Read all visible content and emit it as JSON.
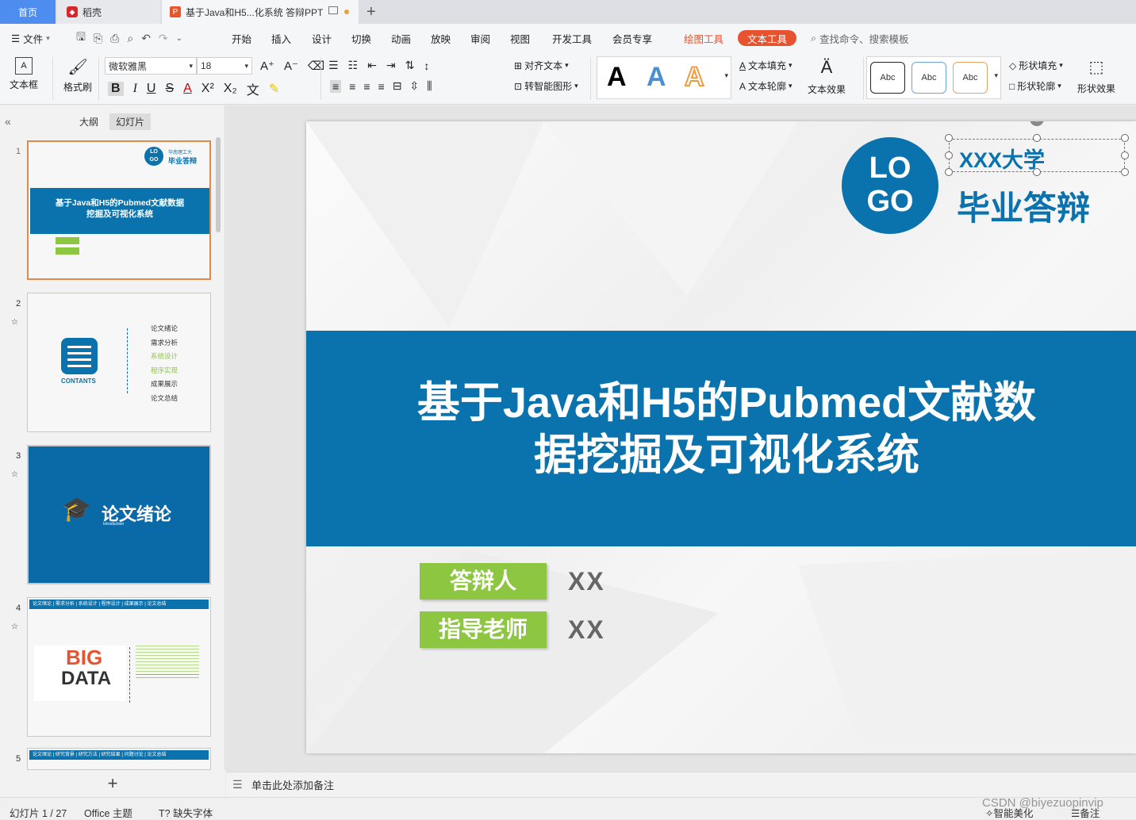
{
  "tabs": {
    "home": "首页",
    "daoke": "稻壳",
    "doc": "基于Java和H5...化系统 答辩PPT"
  },
  "menu": {
    "file": "文件",
    "items": [
      "开始",
      "插入",
      "设计",
      "切换",
      "动画",
      "放映",
      "审阅",
      "视图",
      "开发工具",
      "会员专享"
    ],
    "draw_tool": "绘图工具",
    "text_tool": "文本工具",
    "search": "查找命令、搜索模板"
  },
  "ribbon": {
    "textbox": "文本框",
    "format_painter": "格式刷",
    "font_name": "微软雅黑",
    "font_size": "18",
    "align_text": "对齐文本",
    "smart_shape": "转智能图形",
    "text_fill": "文本填充",
    "text_outline": "文本轮廓",
    "text_effect": "文本效果",
    "abc": "Abc",
    "shape_fill": "形状填充",
    "shape_outline": "形状轮廓",
    "shape_effect": "形状效果",
    "big_a": "A"
  },
  "panel": {
    "outline": "大纲",
    "slides": "幻灯片"
  },
  "thumbs": {
    "t1_title": "基于Java和H5的Pubmed文献数据挖掘及可视化系统",
    "t1_uni": "华南理工大",
    "t1_def": "毕业答辩",
    "t2_contents": "CONTANTS",
    "t2_items": [
      "论文绪论",
      "需求分析",
      "系统设计",
      "程序实现",
      "成果展示",
      "论文总结"
    ],
    "t3_title": "论文绪论",
    "t3_sub": "Introduction",
    "t4_nav": "论文绪论 | 需求分析 | 系统设计 | 程序设计 | 成果展示 | 论文总结",
    "t4_big": "BIG",
    "t4_data": "DATA",
    "t5_nav": "论文绪论 | 研究背景 | 研究方法 | 研究结果 | 问题讨论 | 论文总结"
  },
  "slide": {
    "logo_top": "LO",
    "logo_bottom": "GO",
    "university": "XXX大学",
    "defense": "毕业答辩",
    "title_line1": "基于Java和H5的Pubmed文献数",
    "title_line2": "据挖掘及可视化系统",
    "label_defender": "答辩人",
    "label_advisor": "指导老师",
    "defender": "XX",
    "advisor": "XX"
  },
  "notes": "单击此处添加备注",
  "status": {
    "slide_count": "幻灯片 1 / 27",
    "theme": "Office 主题",
    "missing_font": "缺失字体",
    "smart_beautify": "智能美化",
    "notes_btn": "备注",
    "watermark": "CSDN @biyezuopinvip"
  },
  "colors": {
    "brand_blue": "#0a72ad",
    "green": "#8dc641",
    "accent": "#e8532f"
  }
}
